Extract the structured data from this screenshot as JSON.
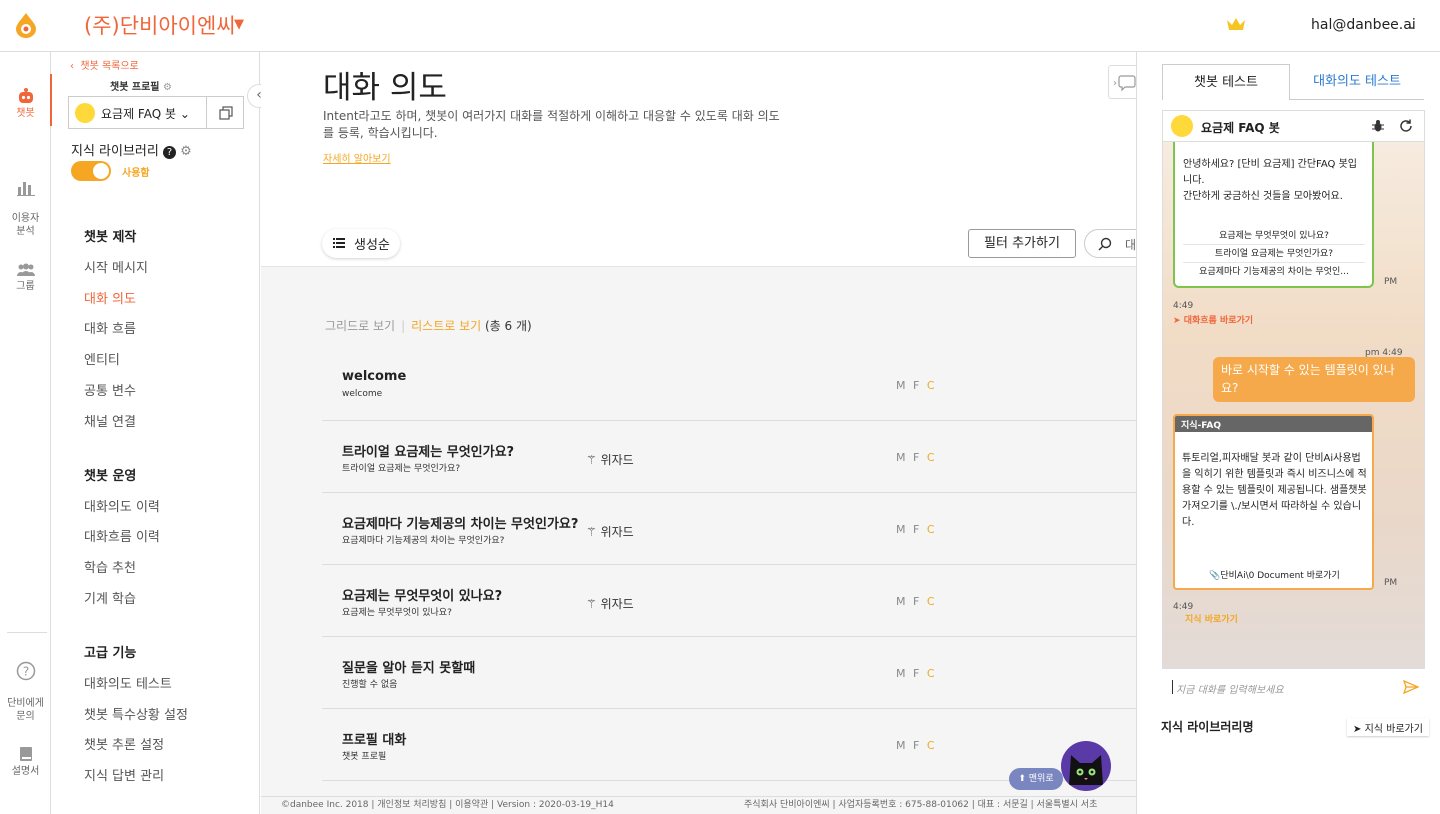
{
  "header": {
    "company": "(주)단비아이엔씨",
    "user_email": "hal@danbee.ai"
  },
  "rail": {
    "items": [
      {
        "label": "챗봇"
      },
      {
        "label": "이용자\n분석"
      },
      {
        "label": "그룹"
      },
      {
        "label": "단비에게\n문의"
      },
      {
        "label": "설명서"
      }
    ]
  },
  "sidebar": {
    "back_link": "챗봇 목록으로",
    "profile_label": "챗봇 프로필",
    "bot_name": "요금제 FAQ 봇",
    "knowledge_library": "지식 라이브러리",
    "toggle_label": "사용함",
    "sections": [
      {
        "title": "챗봇 제작",
        "items": [
          "시작 메시지",
          "대화 의도",
          "대화 흐름",
          "엔티티",
          "공통 변수",
          "채널 연결"
        ]
      },
      {
        "title": "챗봇 운영",
        "items": [
          "대화의도 이력",
          "대화흐름 이력",
          "학습 추천",
          "기계 학습"
        ]
      },
      {
        "title": "고급 기능",
        "items": [
          "대화의도 테스트",
          "챗봇 특수상황 설정",
          "챗봇 추론 설정",
          "지식 답변 관리"
        ]
      }
    ]
  },
  "main": {
    "title": "대화 의도",
    "description": "Intent라고도 하며, 챗봇이 여러가지 대화를 적절하게 이해하고 대응할 수 있도록 대화 의도를 등록, 학습시킵니다.",
    "learn_more": "자세히 알아보기",
    "sort_label": "생성순",
    "filter_label": "필터 추가하기",
    "search_placeholder": "대",
    "view_grid": "그리드로 보기",
    "view_list": "리스트로 보기",
    "count_text": "(총 6 개)",
    "wizard_label": "위자드",
    "rows": [
      {
        "title": "welcome",
        "sub": "welcome",
        "wizard": false,
        "m": "M",
        "f": "F",
        "c": "C"
      },
      {
        "title": "트라이얼 요금제는 무엇인가요?",
        "sub": "트라이얼 요금제는 무엇인가요?",
        "wizard": true,
        "m": "M",
        "f": "F",
        "c": "C"
      },
      {
        "title": "요금제마다 기능제공의 차이는 무엇인가요?",
        "sub": "요금제마다 기능제공의 차이는 무엇인가요?",
        "wizard": true,
        "m": "M",
        "f": "F",
        "c": "C"
      },
      {
        "title": "요금제는 무엇무엇이 있나요?",
        "sub": "요금제는 무엇무엇이 있나요?",
        "wizard": true,
        "m": "M",
        "f": "F",
        "c": "C"
      },
      {
        "title": "질문을 알아 듣지 못할때",
        "sub": "진행할 수 없음",
        "wizard": false,
        "m": "M",
        "f": "F",
        "c": "C"
      },
      {
        "title": "프로필 대화",
        "sub": "챗봇 프로필",
        "wizard": false,
        "m": "M",
        "f": "F",
        "c": "C"
      }
    ],
    "to_top": "맨위로"
  },
  "footer": {
    "left": "©danbee Inc. 2018 | 개인정보 처리방침 | 이용약관 | Version : 2020-03-19_H14",
    "right": "주식회사 단비아이엔씨 | 사업자등록번호 : 675-88-01062 | 대표 : 서문길 | 서울특별시 서초"
  },
  "test_panel": {
    "tab_bot": "챗봇 테스트",
    "tab_intent": "대화의도 테스트",
    "bot_name": "요금제 FAQ 봇",
    "greeting": "안녕하세요? [단비 요금제] 간단FAQ 봇입니다.\n간단하게 궁금하신 것들을 모아봤어요.",
    "greeting_buttons": [
      "요금제는 무엇무엇이 있나요?",
      "트라이얼 요금제는 무엇인가요?",
      "요금제마다 기능제공의 차이는 무엇인..."
    ],
    "time_1": "4:49",
    "pm_1": "PM",
    "flow_link": "대화흐름 바로가기",
    "user_time": "pm 4:49",
    "user_message": "바로 시작할 수 있는 템플릿이 있나요?",
    "faq_header": "지식-FAQ",
    "faq_text": "튜토리얼,피자배달 봇과 같이 단비Ai사용법을 익히기 위한 템플릿과 즉시 비즈니스에 적용할 수 있는 템플릿이 제공됩니다. 샘플챗봇 가져오기를 \\./보시면서 따라하실 수 있습니다.",
    "faq_button": "단비Ai\\0 Document 바로가기",
    "time_2": "4:49",
    "pm_2": "PM",
    "knowledge_link": "지식 바로가기",
    "input_placeholder": "지금 대화를 입력해보세요",
    "kl_name_label": "지식 라이브러리명",
    "kl_go": "지식 바로가기"
  },
  "colors": {
    "brand": "#f0663a",
    "accent": "#f5a623",
    "link_blue": "#2d7bd0",
    "user_bubble": "#f5a94a",
    "bot_card_border": "#7cc44c"
  }
}
